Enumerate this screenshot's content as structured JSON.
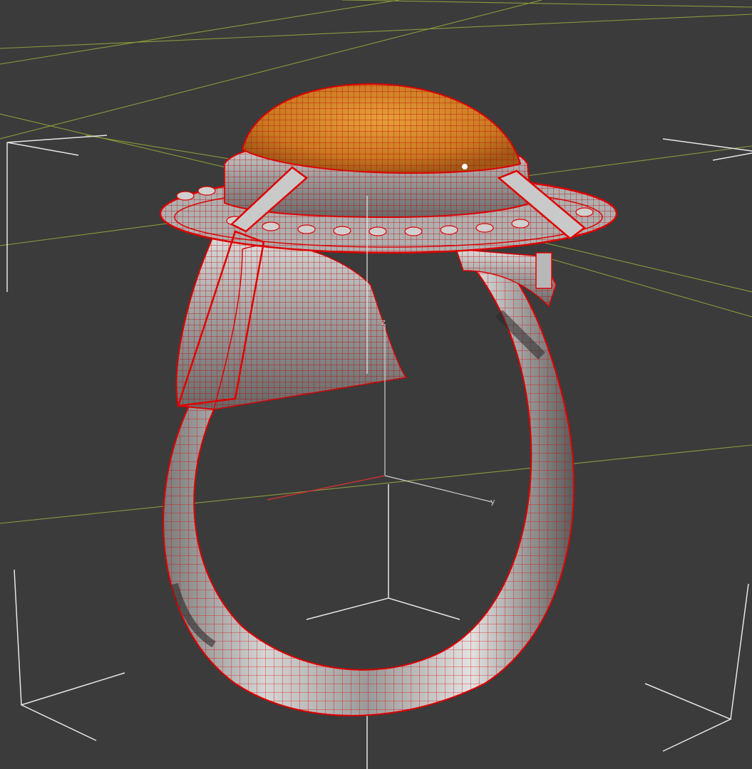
{
  "viewport": {
    "background": "#3b3b3b",
    "grid_color": "#8a9a3a",
    "bbox_bracket_color": "#e6e6e6",
    "wire_color": "#e00000",
    "metal_light": "#c8c8c8",
    "metal_dark": "#5a5a5a",
    "gem_color": "#d08a2a",
    "axis_z_color": "#cfcfcf",
    "axis_x_color": "#c83232",
    "axis_y_color": "#cfcfcf"
  },
  "axes": {
    "z_label": "z",
    "y_label": "y"
  }
}
